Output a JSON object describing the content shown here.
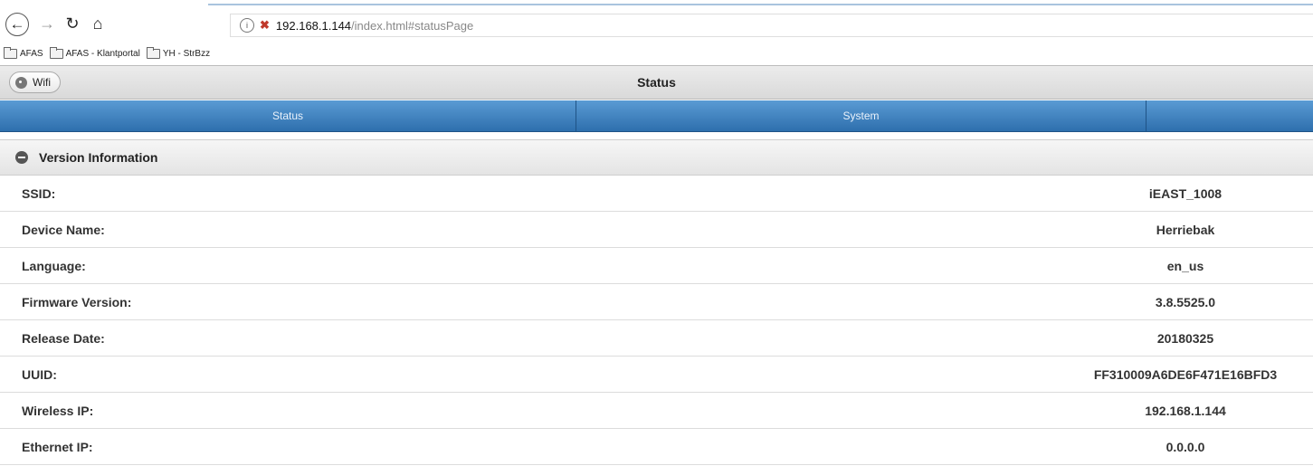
{
  "browser": {
    "url_host": "192.168.1.144",
    "url_path": "/index.html#statusPage",
    "bookmarks": [
      "AFAS",
      "AFAS - Klantportal",
      "YH - StrBzz"
    ]
  },
  "header": {
    "back_label": "Wifi",
    "title": "Status"
  },
  "navbar": {
    "tabs": [
      "Status",
      "System",
      ""
    ]
  },
  "section": {
    "title": "Version Information",
    "rows": [
      {
        "label": "SSID:",
        "value": "iEAST_1008"
      },
      {
        "label": "Device Name:",
        "value": "Herriebak"
      },
      {
        "label": "Language:",
        "value": "en_us"
      },
      {
        "label": "Firmware Version:",
        "value": "3.8.5525.0"
      },
      {
        "label": "Release Date:",
        "value": "20180325"
      },
      {
        "label": "UUID:",
        "value": "FF310009A6DE6F471E16BFD3"
      },
      {
        "label": "Wireless IP:",
        "value": "192.168.1.144"
      },
      {
        "label": "Ethernet IP:",
        "value": "0.0.0.0"
      }
    ]
  },
  "colors": {
    "navbar_top": "#5a9bd4",
    "navbar_bottom": "#2e6fad"
  },
  "icons": [
    "back-icon",
    "forward-icon",
    "reload-icon",
    "home-icon",
    "info-icon",
    "insecure-lock-icon",
    "folder-icon",
    "home-circle-icon",
    "collapse-minus-icon"
  ]
}
